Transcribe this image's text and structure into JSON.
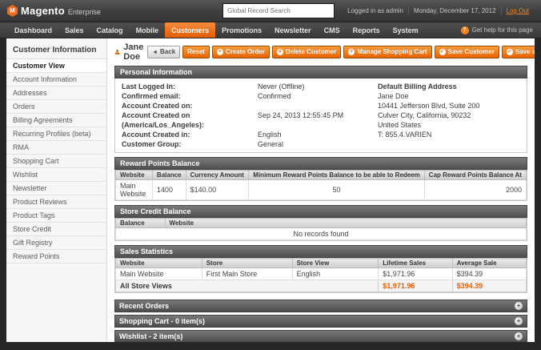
{
  "colors": {
    "accent_orange": "#e8650c",
    "totals_orange": "#e85d00",
    "logo_orange": "#f26822"
  },
  "icons": {
    "logo_mark": "M",
    "back_arrow": "◄",
    "plus": "+",
    "cross": "×",
    "check": "✓",
    "help": "?",
    "expand": "+"
  },
  "header": {
    "logo_text": "Magento",
    "logo_suffix": "Enterprise",
    "search_placeholder": "Global Record Search",
    "logged_in": "Logged in as admin",
    "date": "Monday, December 17, 2012",
    "logout": "Log Out"
  },
  "nav": {
    "items": [
      {
        "label": "Dashboard"
      },
      {
        "label": "Sales"
      },
      {
        "label": "Catalog"
      },
      {
        "label": "Mobile"
      },
      {
        "label": "Customers"
      },
      {
        "label": "Promotions"
      },
      {
        "label": "Newsletter"
      },
      {
        "label": "CMS"
      },
      {
        "label": "Reports"
      },
      {
        "label": "System"
      }
    ],
    "help": "Get help for this page"
  },
  "sidebar": {
    "title": "Customer Information",
    "items": [
      {
        "label": "Customer View"
      },
      {
        "label": "Account Information"
      },
      {
        "label": "Addresses"
      },
      {
        "label": "Orders"
      },
      {
        "label": "Billing Agreements"
      },
      {
        "label": "Recurring Profiles (beta)"
      },
      {
        "label": "RMA"
      },
      {
        "label": "Shopping Cart"
      },
      {
        "label": "Wishlist"
      },
      {
        "label": "Newsletter"
      },
      {
        "label": "Product Reviews"
      },
      {
        "label": "Product Tags"
      },
      {
        "label": "Store Credit"
      },
      {
        "label": "Gift Registry"
      },
      {
        "label": "Reward Points"
      }
    ]
  },
  "page": {
    "title": "Jane Doe",
    "buttons": {
      "back": "Back",
      "reset": "Reset",
      "create_order": "Create Order",
      "delete_customer": "Delete Customer",
      "manage_cart": "Manage Shopping Cart",
      "save": "Save Customer",
      "save_continue": "Save and Continue Edit"
    }
  },
  "personal_info": {
    "title": "Personal Information",
    "fields": [
      {
        "label": "Last Logged In:",
        "value": "Never (Offline)"
      },
      {
        "label": "Confirmed email:",
        "value": "Confirmed"
      },
      {
        "label": "Account Created on:",
        "value": ""
      },
      {
        "label": "Account Created on (America/Los_Angeles):",
        "value": "Sep 24, 2013 12:55:45 PM"
      },
      {
        "label": "Account Created in:",
        "value": "English"
      },
      {
        "label": "Customer Group:",
        "value": "General"
      }
    ],
    "billing_title": "Default Billing Address",
    "billing_lines": [
      "Jane Doe",
      "10441 Jefferson Blvd, Suite 200",
      "Culver City, California, 90232",
      "United States",
      "T: 855.4.VARIEN"
    ]
  },
  "reward_points": {
    "title": "Reward Points Balance",
    "columns": [
      "Website",
      "Balance",
      "Currency Amount",
      "Minimum Reward Points Balance to be able to Redeem",
      "Cap Reward Points Balance At"
    ],
    "row": [
      "Main Website",
      "1400",
      "$140.00",
      "50",
      "2000"
    ]
  },
  "store_credit": {
    "title": "Store Credit Balance",
    "columns": [
      "Balance",
      "Website"
    ],
    "empty_text": "No records found"
  },
  "sales_stats": {
    "title": "Sales Statistics",
    "columns": [
      "Website",
      "Store",
      "Store View",
      "Lifetime Sales",
      "Average Sale"
    ],
    "row": [
      "Main Website",
      "First Main Store",
      "English",
      "$1,971.96",
      "$394.39"
    ],
    "total_label": "All Store Views",
    "total_lifetime": "$1,971.96",
    "total_average": "$394.39"
  },
  "accordions": [
    {
      "label": "Recent Orders"
    },
    {
      "label": "Shopping Cart - 0 item(s)"
    },
    {
      "label": "Wishlist - 2 item(s)"
    }
  ]
}
